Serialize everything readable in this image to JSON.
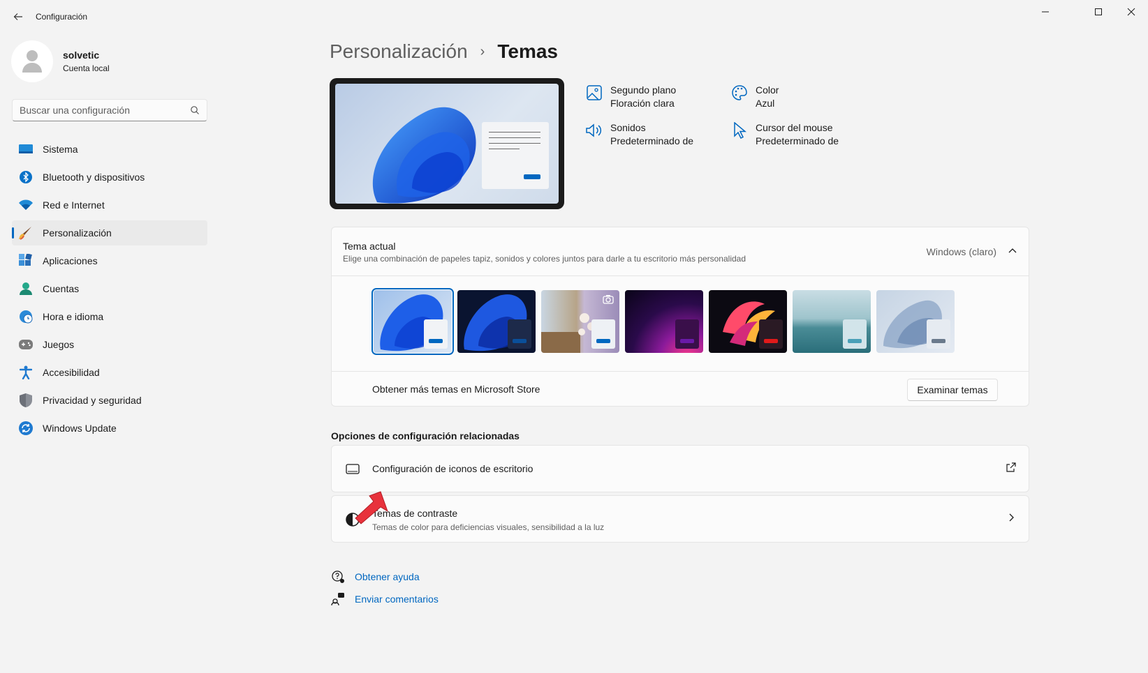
{
  "window": {
    "title": "Configuración",
    "controls": {
      "minimize": "minimize-icon",
      "maximize": "maximize-icon",
      "close": "close-icon"
    }
  },
  "profile": {
    "name": "solvetic",
    "account_type": "Cuenta local"
  },
  "search": {
    "placeholder": "Buscar una configuración"
  },
  "sidebar": {
    "items": [
      {
        "label": "Sistema",
        "icon": "system-icon"
      },
      {
        "label": "Bluetooth y dispositivos",
        "icon": "bluetooth-icon"
      },
      {
        "label": "Red e Internet",
        "icon": "wifi-icon"
      },
      {
        "label": "Personalización",
        "icon": "brush-icon",
        "active": true
      },
      {
        "label": "Aplicaciones",
        "icon": "apps-icon"
      },
      {
        "label": "Cuentas",
        "icon": "account-icon"
      },
      {
        "label": "Hora e idioma",
        "icon": "clock-globe-icon"
      },
      {
        "label": "Juegos",
        "icon": "gamepad-icon"
      },
      {
        "label": "Accesibilidad",
        "icon": "accessibility-icon"
      },
      {
        "label": "Privacidad y seguridad",
        "icon": "shield-icon"
      },
      {
        "label": "Windows Update",
        "icon": "update-icon"
      }
    ]
  },
  "breadcrumb": {
    "parent": "Personalización",
    "separator": "›",
    "current": "Temas"
  },
  "properties": {
    "background": {
      "label": "Segundo plano",
      "value": "Floración clara"
    },
    "color": {
      "label": "Color",
      "value": "Azul"
    },
    "sounds": {
      "label": "Sonidos",
      "value": "Predeterminado de"
    },
    "cursor": {
      "label": "Cursor del mouse",
      "value": "Predeterminado de"
    }
  },
  "theme_section": {
    "title": "Tema actual",
    "description": "Elige una combinación de papeles tapiz, sonidos y colores juntos para darle a tu escritorio más personalidad",
    "current_value": "Windows (claro)",
    "store_text": "Obtener más temas en Microsoft Store",
    "store_button": "Examinar temas",
    "thumbnails": [
      {
        "name": "windows-light",
        "selected": true
      },
      {
        "name": "windows-dark"
      },
      {
        "name": "windows-spotlight"
      },
      {
        "name": "glow"
      },
      {
        "name": "captured-motion"
      },
      {
        "name": "sunrise"
      },
      {
        "name": "flow"
      }
    ]
  },
  "related": {
    "title": "Opciones de configuración relacionadas",
    "desktop_icons": {
      "label": "Configuración de iconos de escritorio"
    },
    "contrast": {
      "label": "Temas de contraste",
      "description": "Temas de color para deficiencias visuales, sensibilidad a la luz"
    }
  },
  "help": {
    "get_help": "Obtener ayuda",
    "feedback": "Enviar comentarios"
  },
  "colors": {
    "accent": "#0067c0",
    "background": "#f3f3f3",
    "card": "#fbfbfb",
    "annotation_arrow": "#e8323c"
  }
}
